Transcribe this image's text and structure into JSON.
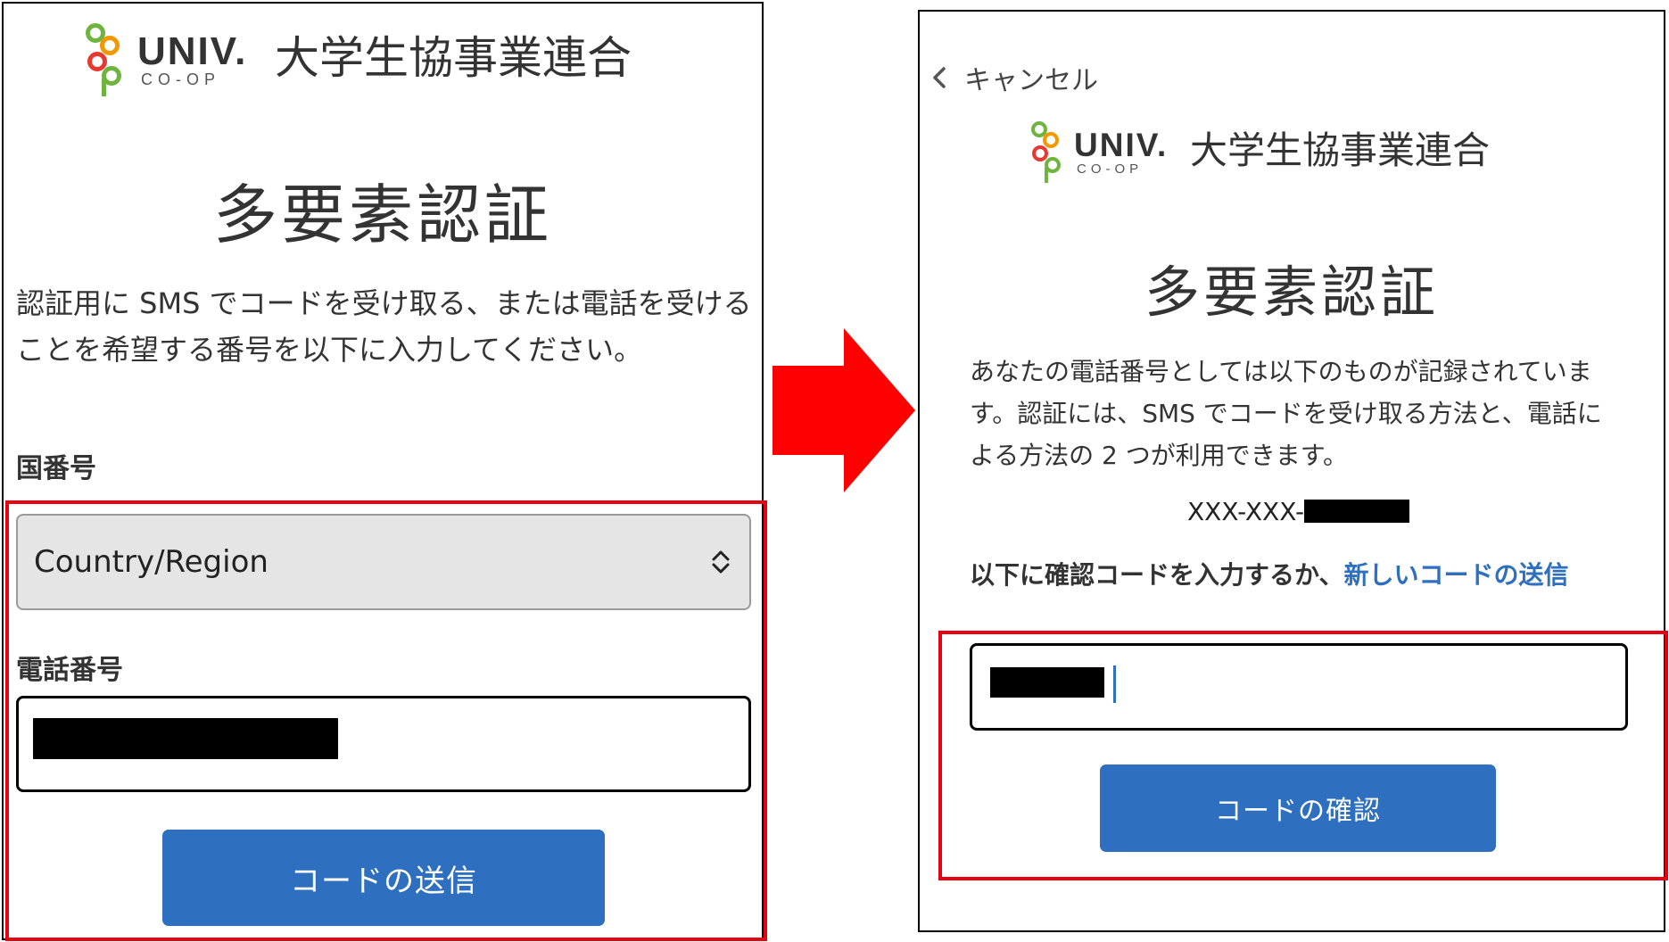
{
  "logo": {
    "univ": "UNIV.",
    "coop": "CO-OP",
    "org": "大学生協事業連合",
    "colors": {
      "green": "#6fb43f",
      "orange": "#f39800",
      "red": "#e8382f",
      "gray": "#333333"
    }
  },
  "left_screen": {
    "title": "多要素認証",
    "instructions": "認証用に SMS でコードを受け取る、または電話を受けることを希望する番号を以下に入力してください。",
    "country_label": "国番号",
    "country_select": {
      "value": "Country/Region",
      "icon": "up-down-chevron-icon"
    },
    "phone_label": "電話番号",
    "send_button": "コードの送信"
  },
  "right_screen": {
    "cancel_link": "キャンセル",
    "cancel_icon": "chevron-left-icon",
    "title": "多要素認証",
    "description": "あなたの電話番号としては以下のものが記録されています。認証には、SMS でコードを受け取る方法と、電話による方法の 2 つが利用できます。",
    "phone_masked": "XXX-XXX-",
    "code_prompt": "以下に確認コードを入力するか、",
    "resend_link": "新しいコードの送信",
    "verify_button": "コードの確認"
  },
  "annotation": {
    "arrow_icon": "right-arrow-icon",
    "highlight_color": "#e60012",
    "button_color": "#2e6fc0"
  }
}
